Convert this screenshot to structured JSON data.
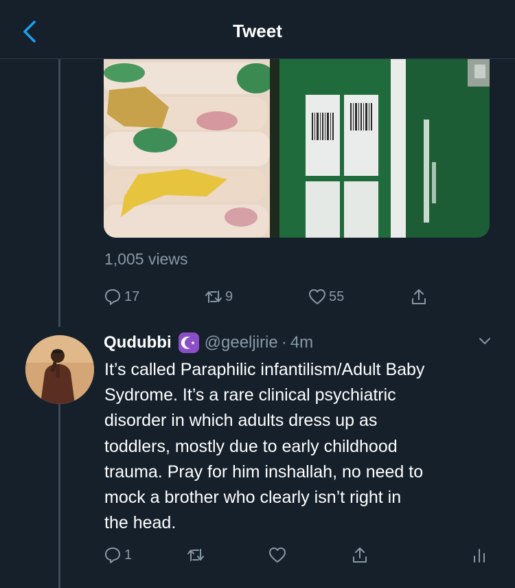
{
  "header": {
    "title": "Tweet",
    "back_icon": "chevron-left-icon"
  },
  "tweet": {
    "views": "1,005 views",
    "actions": {
      "replies": "17",
      "retweets": "9",
      "likes": "55"
    }
  },
  "reply": {
    "name": "Qudubbi",
    "badge_icon": "star-and-crescent-icon",
    "handle": "@geeljirie",
    "separator": "·",
    "time": "4m",
    "text": "It’s called Paraphilic infantilism/Adult Baby\nSydrome. It’s a rare clinical psychiatric\ndisorder in which adults dress up as\ntoddlers, mostly due to early childhood\ntrauma. Pray for him inshallah, no need to\nmock a brother who clearly isn’t right in\nthe head.",
    "actions": {
      "replies": "1"
    }
  },
  "colors": {
    "background": "#15202b",
    "secondary_text": "#8899a6",
    "accent": "#1da1f2",
    "badge": "#8b4ec6"
  }
}
